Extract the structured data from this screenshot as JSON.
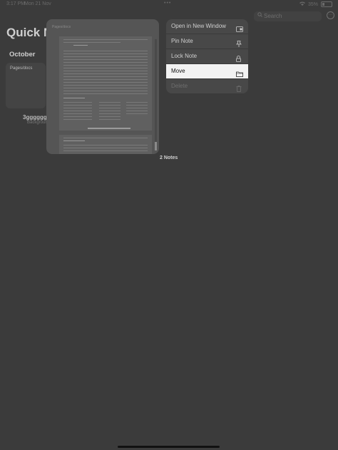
{
  "status_bar": {
    "time": "3:17 PM",
    "date": "Mon 21 Nov",
    "dots": "•••",
    "battery_pct": "35%"
  },
  "app": {
    "title": "Quick Notes",
    "month": "October",
    "note_card_title": "Pages/docs",
    "side_title": "3ggggggg",
    "side_subtitle": "Background",
    "notes_count": "2 Notes",
    "search_placeholder": "Search",
    "more_glyph": "···"
  },
  "preview": {
    "title": "Pages/docs"
  },
  "context_menu": {
    "items": [
      {
        "label": "Open in New Window",
        "icon": "new-window-icon",
        "state": "normal"
      },
      {
        "label": "Pin Note",
        "icon": "pin-icon",
        "state": "normal"
      },
      {
        "label": "Lock Note",
        "icon": "lock-icon",
        "state": "normal"
      },
      {
        "label": "Move",
        "icon": "folder-icon",
        "state": "highlighted"
      },
      {
        "label": "Delete",
        "icon": "trash-icon",
        "state": "disabled"
      }
    ]
  },
  "colors": {
    "background": "#3b3b3b",
    "menu_bg": "#484848",
    "menu_highlight": "#f2f2f2",
    "disabled_text": "#6e6e6e"
  }
}
